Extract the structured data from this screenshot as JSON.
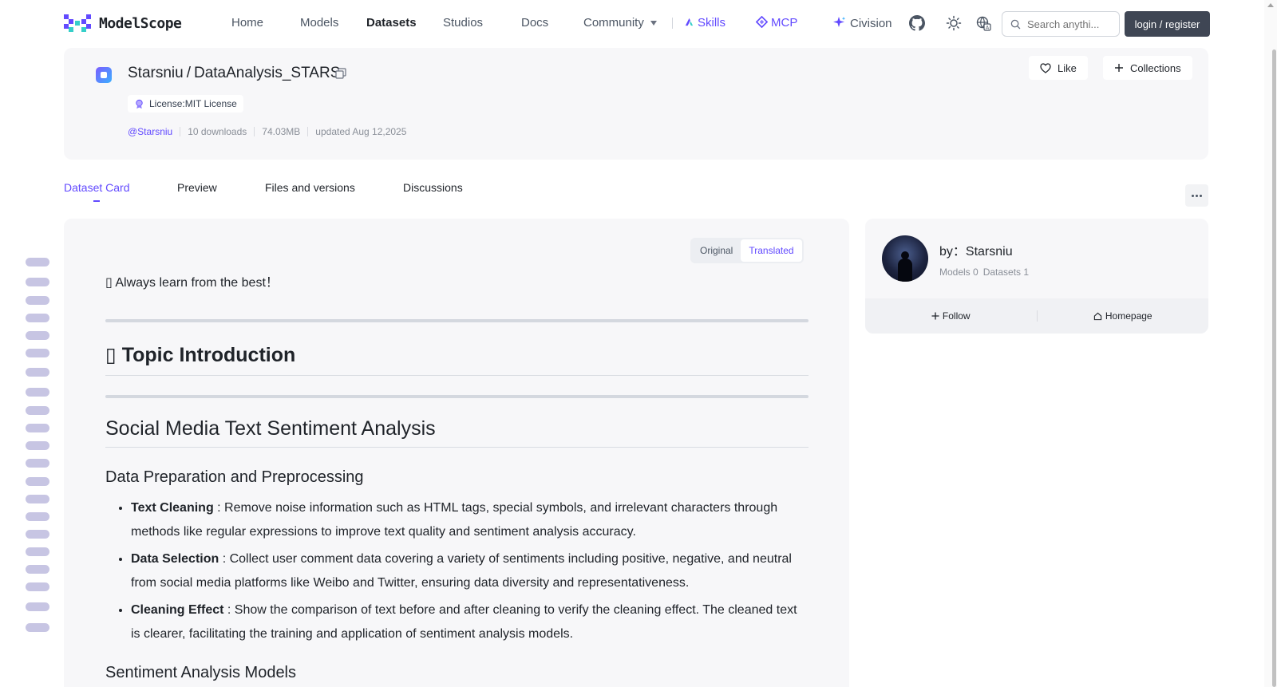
{
  "brand": {
    "logo_text": "ModelScope",
    "accent": "#624aff"
  },
  "nav": {
    "home": "Home",
    "models": "Models",
    "datasets": "Datasets",
    "studios": "Studios",
    "docs": "Docs",
    "community": "Community",
    "skills": "Skills",
    "mcp": "MCP",
    "civision": "Civision",
    "search_placeholder": "Search anythi...",
    "login": "login / register"
  },
  "dataset": {
    "owner": "Starsniu",
    "separator": "/",
    "name": "DataAnalysis_STARS",
    "license": "License:MIT License",
    "author_link": "@Starsniu",
    "downloads": "10 downloads",
    "size": "74.03MB",
    "updated": "updated Aug 12,2025",
    "like": "Like",
    "collections": "Collections"
  },
  "tabs": {
    "card": "Dataset Card",
    "preview": "Preview",
    "files": "Files and versions",
    "discussions": "Discussions"
  },
  "content": {
    "toggle_original": "Original",
    "toggle_translated": "Translated",
    "quote": "▯ Always learn from the best！",
    "h_topic": "▯ Topic Introduction",
    "h_social": "Social Media Text Sentiment Analysis",
    "h_prep": "Data Preparation and Preprocessing",
    "items": [
      {
        "term": "Text Cleaning",
        "text": " : Remove noise information such as HTML tags, special symbols, and irrelevant characters through methods like regular expressions to improve text quality and sentiment analysis accuracy."
      },
      {
        "term": "Data Selection",
        "text": " : Collect user comment data covering a variety of sentiments including positive, negative, and neutral from social media platforms like Weibo and Twitter, ensuring data diversity and representativeness."
      },
      {
        "term": "Cleaning Effect",
        "text": " : Show the comparison of text before and after cleaning to verify the cleaning effect. The cleaned text is clearer, facilitating the training and application of sentiment analysis models."
      }
    ],
    "h_models": "Sentiment Analysis Models"
  },
  "author": {
    "by": "by：Starsniu",
    "models": "Models 0",
    "datasets": "Datasets 1",
    "follow": "Follow",
    "homepage": "Homepage"
  }
}
